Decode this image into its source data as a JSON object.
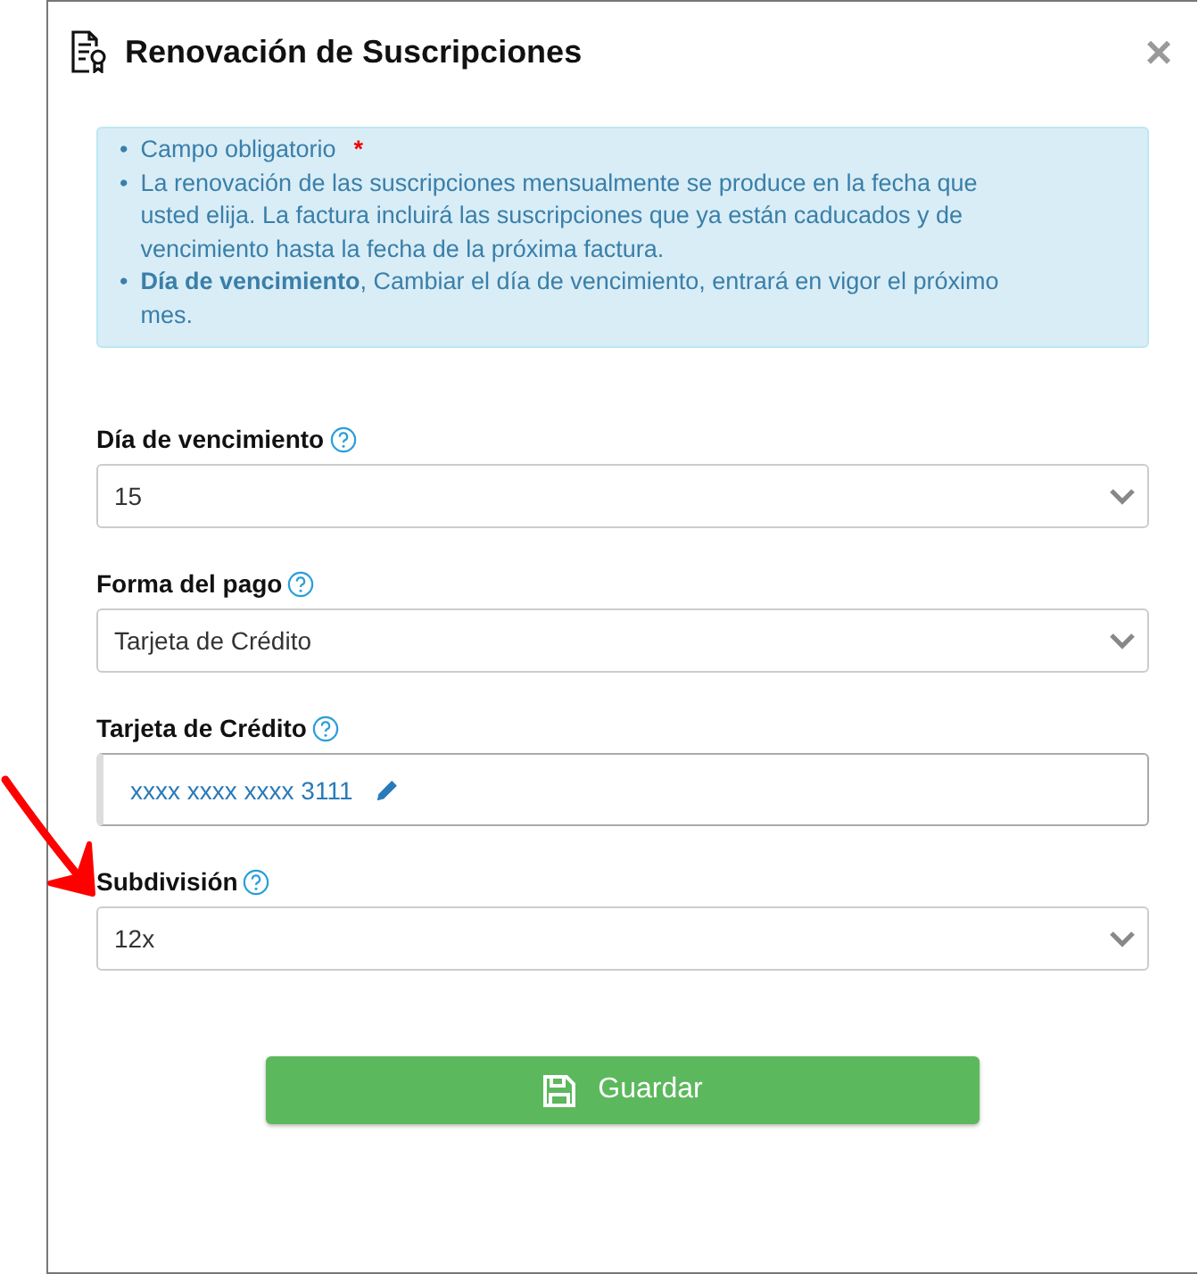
{
  "dialog": {
    "title": "Renovación de Suscripciones",
    "close": "×"
  },
  "info": [
    {
      "bullet": "•",
      "text": "Campo obligatorio",
      "required_mark": "*"
    },
    {
      "bullet": "•",
      "text": "La renovación de las suscripciones mensualmente se produce en la fecha que usted elija. La factura incluirá las suscripciones que ya están caducados y de vencimiento hasta la fecha de la próxima factura."
    },
    {
      "bullet": "•",
      "text": "**Día de vencimiento**, Cambiar el día de vencimiento, entrará en vigor el próximo mes."
    }
  ],
  "fields": [
    {
      "kind": "select",
      "label": "Día de vencimiento",
      "value": "15"
    },
    {
      "kind": "select",
      "label": "Forma del pago",
      "value": "Tarjeta de Crédito"
    },
    {
      "kind": "card",
      "label": "Tarjeta de Crédito",
      "value": "xxxx xxxx xxxx 3111"
    },
    {
      "kind": "select",
      "label": "Subdivisión",
      "value": "12x"
    }
  ],
  "save_button": {
    "label": "Guardar"
  },
  "annotations": [
    {
      "kind": "arrow"
    }
  ]
}
